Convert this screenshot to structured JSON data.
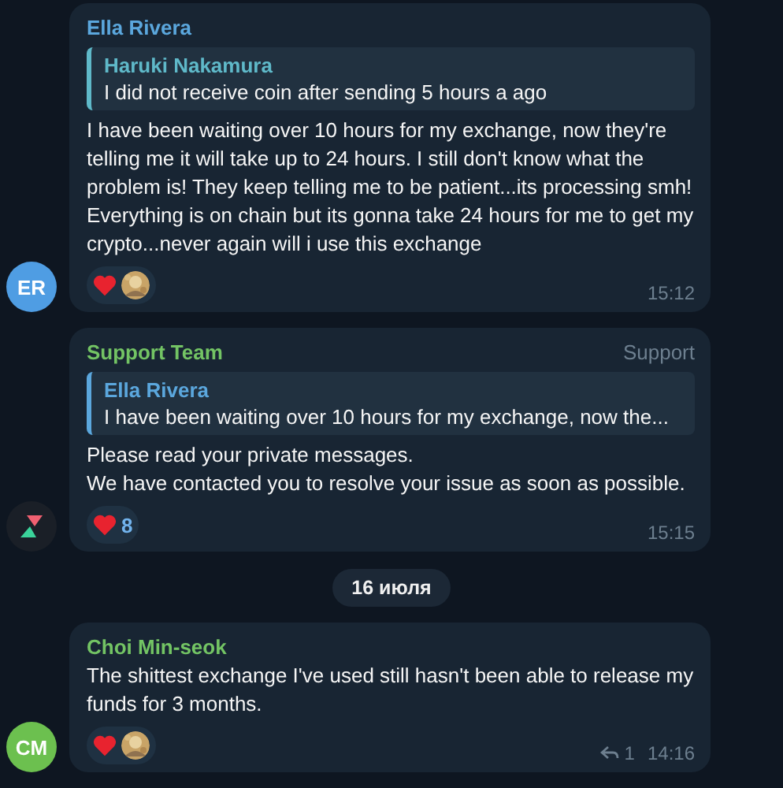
{
  "feed": [
    {
      "kind": "message",
      "sender": "Ella Rivera",
      "color": "#5ba7dd",
      "avatar": {
        "kind": "initials",
        "text": "ER",
        "color": "#4f9de3"
      },
      "reply": {
        "sender": "Haruki Nakamura",
        "text": "I did not receive coin after sending 5 hours a ago",
        "color": "#5fb9c9"
      },
      "text": "I have been waiting over 10 hours for my exchange, now they're telling me it will take up to 24 hours. I still don't know what the problem is! They keep telling me to be patient...its processing smh! Everything is on chain but its gonna take 24 hours for me to get my crypto...never again will i use this exchange",
      "reactions": [
        {
          "kind": "user"
        }
      ],
      "time": "15:12"
    },
    {
      "kind": "message",
      "sender": "Support Team",
      "color": "#73c464",
      "badge": "Support",
      "avatar": {
        "kind": "logo"
      },
      "reply": {
        "sender": "Ella Rivera",
        "text": "I have been waiting over 10 hours for my exchange, now the...",
        "color": "#5ba7dd"
      },
      "text": "Please read your private messages.\nWe have contacted you to resolve your issue as soon as possible.",
      "reactions": [
        {
          "kind": "count",
          "count": "8"
        }
      ],
      "time": "15:15"
    },
    {
      "kind": "date",
      "text": "16 июля"
    },
    {
      "kind": "message",
      "sender": "Choi Min-seok",
      "color": "#73c464",
      "avatar": {
        "kind": "initials",
        "text": "CM",
        "color": "#6cc04f"
      },
      "text": "The shittest exchange I've used still hasn't been able to release my funds for 3 months.",
      "reactions": [
        {
          "kind": "user"
        }
      ],
      "replies": "1",
      "time": "14:16"
    }
  ]
}
